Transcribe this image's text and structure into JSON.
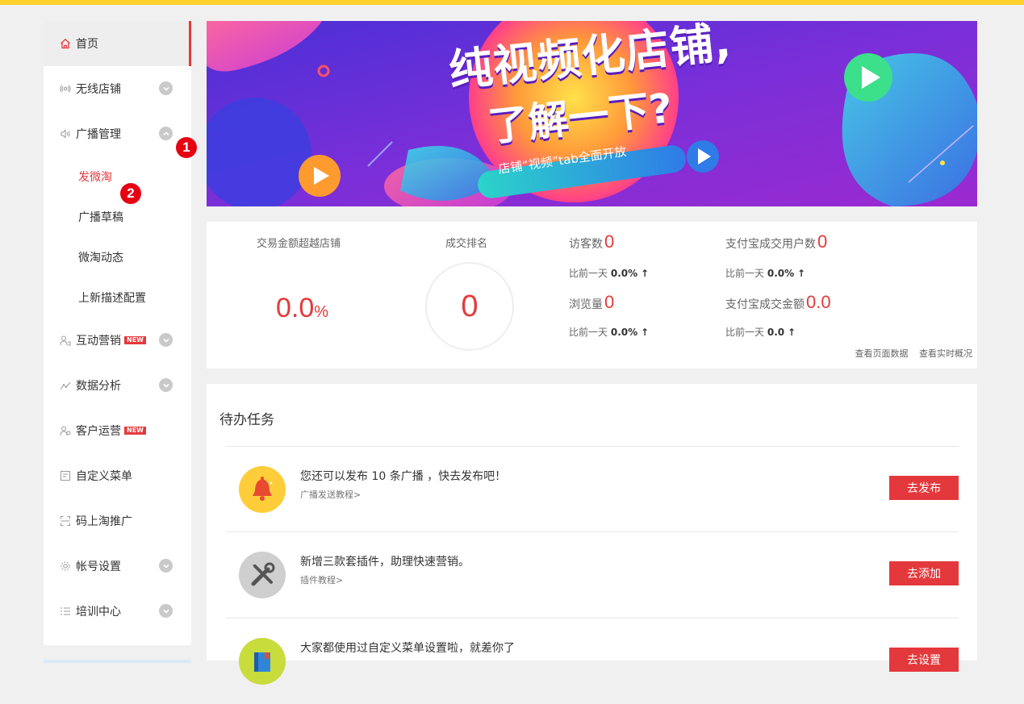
{
  "colors": {
    "accent": "#e4393c",
    "topbar": "#ffd02e"
  },
  "sidebar": {
    "home": {
      "label": "首页",
      "icon": "home-icon"
    },
    "items": [
      {
        "label": "无线店铺",
        "icon": "wireless-icon"
      },
      {
        "label": "广播管理",
        "icon": "broadcast-icon"
      }
    ],
    "subitems": [
      "发微淘",
      "广播草稿",
      "微淘动态",
      "上新描述配置"
    ],
    "items2": [
      {
        "label": "互动营销",
        "icon": "interactive-icon",
        "badge": "NEW"
      },
      {
        "label": "数据分析",
        "icon": "analytics-icon"
      },
      {
        "label": "客户运营",
        "icon": "customer-icon",
        "badge": "NEW"
      },
      {
        "label": "自定义菜单",
        "icon": "menu-edit-icon"
      },
      {
        "label": "码上淘推广",
        "icon": "qrcode-icon"
      },
      {
        "label": "帐号设置",
        "icon": "gear-icon"
      },
      {
        "label": "培训中心",
        "icon": "list-icon"
      }
    ]
  },
  "annotations": [
    "1",
    "2"
  ],
  "banner": {
    "line1": "纯视频化店铺,",
    "line2": "了解一下?",
    "tag": "店铺“视频”tab全面开放"
  },
  "stats": {
    "exceed_label": "交易金额超越店铺",
    "exceed_value": "0.0",
    "exceed_unit": "%",
    "rank_label": "成交排名",
    "rank_value": "0",
    "visitors_label": "访客数",
    "visitors_value": "0",
    "visitors_cmp_label": "比前一天",
    "visitors_cmp_value": "0.0%",
    "views_label": "浏览量",
    "views_value": "0",
    "views_cmp_label": "比前一天",
    "views_cmp_value": "0.0%",
    "alipay_users_label": "支付宝成交用户数",
    "alipay_users_value": "0",
    "alipay_users_cmp_label": "比前一天",
    "alipay_users_cmp_value": "0.0%",
    "alipay_amount_label": "支付宝成交金额",
    "alipay_amount_value": "0.0",
    "alipay_amount_cmp_label": "比前一天",
    "alipay_amount_cmp_value": "0.0",
    "arrow": "↑",
    "link_page": "查看页面数据",
    "link_realtime": "查看实时概况"
  },
  "tasks": {
    "title": "待办任务",
    "items": [
      {
        "text": "您还可以发布 10 条广播 ，快去发布吧！",
        "sub": "广播发送教程>",
        "button": "去发布",
        "icon": "bell-icon"
      },
      {
        "text": "新增三款套插件，助理快速营销。",
        "sub": "插件教程>",
        "button": "去添加",
        "icon": "tools-icon"
      },
      {
        "text": "大家都使用过自定义菜单设置啦，就差你了",
        "sub": "",
        "button": "去设置",
        "icon": "book-icon"
      }
    ]
  }
}
